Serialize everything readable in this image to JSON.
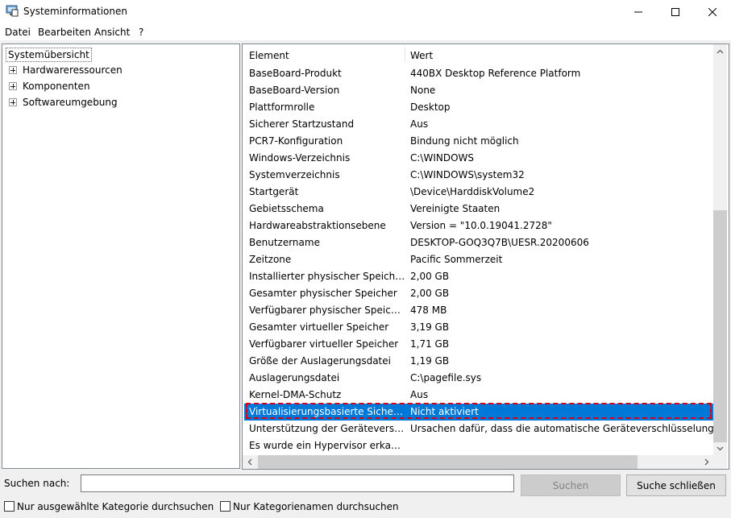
{
  "window": {
    "title": "Systeminformationen"
  },
  "menu": [
    "Datei",
    "Bearbeiten",
    "Ansicht",
    "?"
  ],
  "tree": {
    "root": "Systemübersicht",
    "children": [
      "Hardwareressourcen",
      "Komponenten",
      "Softwareumgebung"
    ]
  },
  "list": {
    "columns": [
      "Element",
      "Wert"
    ],
    "rows": [
      [
        "BaseBoard-Produkt",
        "440BX Desktop Reference Platform"
      ],
      [
        "BaseBoard-Version",
        "None"
      ],
      [
        "Plattformrolle",
        "Desktop"
      ],
      [
        "Sicherer Startzustand",
        "Aus"
      ],
      [
        "PCR7-Konfiguration",
        "Bindung nicht möglich"
      ],
      [
        "Windows-Verzeichnis",
        "C:\\WINDOWS"
      ],
      [
        "Systemverzeichnis",
        "C:\\WINDOWS\\system32"
      ],
      [
        "Startgerät",
        "\\Device\\HarddiskVolume2"
      ],
      [
        "Gebietsschema",
        "Vereinigte Staaten"
      ],
      [
        "Hardwareabstraktionsebene",
        "Version = \"10.0.19041.2728\""
      ],
      [
        "Benutzername",
        "DESKTOP-GOQ3Q7B\\UESR.20200606"
      ],
      [
        "Zeitzone",
        "Pacific Sommerzeit"
      ],
      [
        "Installierter physischer Speicher...",
        "2,00 GB"
      ],
      [
        "Gesamter physischer Speicher",
        "2,00 GB"
      ],
      [
        "Verfügbarer physischer Speicher",
        "478 MB"
      ],
      [
        "Gesamter virtueller Speicher",
        "3,19 GB"
      ],
      [
        "Verfügbarer virtueller Speicher",
        "1,71 GB"
      ],
      [
        "Größe der Auslagerungsdatei",
        "1,19 GB"
      ],
      [
        "Auslagerungsdatei",
        "C:\\pagefile.sys"
      ],
      [
        "Kernel-DMA-Schutz",
        "Aus"
      ],
      [
        "Virtualisierungsbasierte Sicherh...",
        "Nicht aktiviert"
      ],
      [
        "Unterstützung der Geräteversc...",
        "Ursachen dafür, dass die automatische Geräteverschlüsselung nic"
      ],
      [
        "Es wurde ein Hypervisor erkan...",
        ""
      ]
    ],
    "selected_row": "Virtualisierungsbasierte Sicherh..."
  },
  "search": {
    "label": "Suchen nach:",
    "value": "",
    "search_button": "Suchen",
    "close_button": "Suche schließen",
    "checkbox1": "Nur ausgewählte Kategorie durchsuchen",
    "checkbox2": "Nur Kategorienamen durchsuchen"
  },
  "colors": {
    "selection": "#0078d7",
    "annotation": "#d0021b"
  }
}
